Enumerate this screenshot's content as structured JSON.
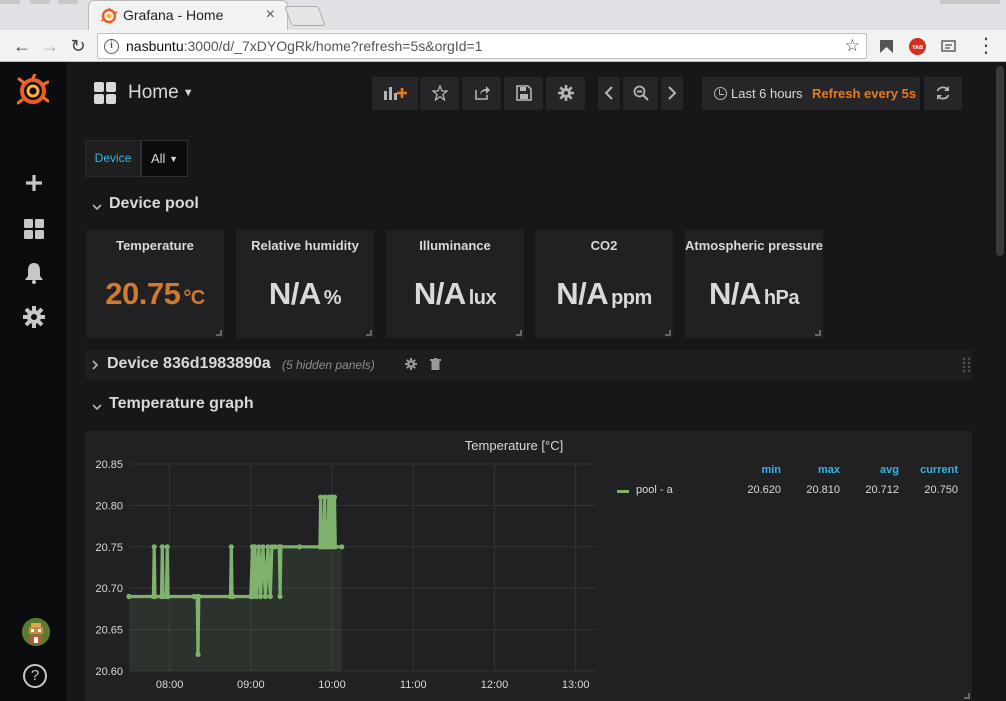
{
  "browser": {
    "tab_title": "Grafana - Home",
    "tab_close": "×",
    "url_host": "nasbuntu",
    "url_rest": ":3000/d/_7xDYOgRk/home?refresh=5s&orgId=1",
    "ext_badge": "YAB"
  },
  "dashboard": {
    "title": "Home",
    "time_range": "Last 6 hours",
    "refresh": "Refresh every 5s",
    "variable": {
      "label": "Device",
      "value": "All"
    }
  },
  "rows": {
    "device_pool": "Device pool",
    "device_row": "Device 836d1983890a",
    "device_row_hidden": "(5 hidden panels)",
    "temp_graph": "Temperature graph"
  },
  "stats": [
    {
      "title": "Temperature",
      "value": "20.75",
      "unit": "°C",
      "color": "#cf7a2c"
    },
    {
      "title": "Relative humidity",
      "value": "N/A",
      "unit": "%"
    },
    {
      "title": "Illuminance",
      "value": "N/A",
      "unit": "lux"
    },
    {
      "title": "CO2",
      "value": "N/A",
      "unit": "ppm"
    },
    {
      "title": "Atmospheric pressure",
      "value": "N/A",
      "unit": "hPa"
    }
  ],
  "graph": {
    "title": "Temperature [°C]",
    "legend": {
      "headers": [
        "min",
        "max",
        "avg",
        "current"
      ],
      "series_name": "pool - a",
      "values": [
        "20.620",
        "20.810",
        "20.712",
        "20.750"
      ]
    }
  },
  "chart_data": {
    "type": "line",
    "title": "Temperature [°C]",
    "xlabel": "",
    "ylabel": "",
    "x_ticks": [
      "08:00",
      "09:00",
      "10:00",
      "11:00",
      "12:00",
      "13:00"
    ],
    "y_ticks": [
      "20.85",
      "20.80",
      "20.75",
      "20.70",
      "20.65",
      "20.60"
    ],
    "ylim": [
      20.6,
      20.85
    ],
    "xlim_hours": [
      7.5,
      13.25
    ],
    "grid": true,
    "series": [
      {
        "name": "pool - a",
        "color": "#7eb26d",
        "points": [
          [
            7.5,
            20.69
          ],
          [
            7.8,
            20.69
          ],
          [
            7.81,
            20.75
          ],
          [
            7.82,
            20.69
          ],
          [
            7.9,
            20.69
          ],
          [
            7.91,
            20.75
          ],
          [
            7.92,
            20.69
          ],
          [
            7.96,
            20.69
          ],
          [
            7.97,
            20.75
          ],
          [
            7.98,
            20.69
          ],
          [
            8.3,
            20.69
          ],
          [
            8.34,
            20.69
          ],
          [
            8.35,
            20.62
          ],
          [
            8.36,
            20.69
          ],
          [
            8.75,
            20.69
          ],
          [
            8.76,
            20.75
          ],
          [
            8.77,
            20.69
          ],
          [
            8.78,
            20.69
          ],
          [
            9.0,
            20.69
          ],
          [
            9.02,
            20.75
          ],
          [
            9.03,
            20.69
          ],
          [
            9.05,
            20.75
          ],
          [
            9.07,
            20.69
          ],
          [
            9.1,
            20.75
          ],
          [
            9.12,
            20.69
          ],
          [
            9.15,
            20.75
          ],
          [
            9.18,
            20.69
          ],
          [
            9.21,
            20.75
          ],
          [
            9.24,
            20.69
          ],
          [
            9.26,
            20.75
          ],
          [
            9.3,
            20.75
          ],
          [
            9.35,
            20.75
          ],
          [
            9.36,
            20.69
          ],
          [
            9.37,
            20.75
          ],
          [
            9.6,
            20.75
          ],
          [
            9.85,
            20.75
          ],
          [
            9.86,
            20.81
          ],
          [
            9.87,
            20.75
          ],
          [
            9.9,
            20.75
          ],
          [
            9.91,
            20.81
          ],
          [
            9.92,
            20.75
          ],
          [
            9.95,
            20.75
          ],
          [
            9.96,
            20.81
          ],
          [
            9.97,
            20.75
          ],
          [
            10.0,
            20.81
          ],
          [
            10.01,
            20.75
          ],
          [
            10.03,
            20.81
          ],
          [
            10.04,
            20.75
          ],
          [
            10.12,
            20.75
          ]
        ]
      }
    ]
  }
}
